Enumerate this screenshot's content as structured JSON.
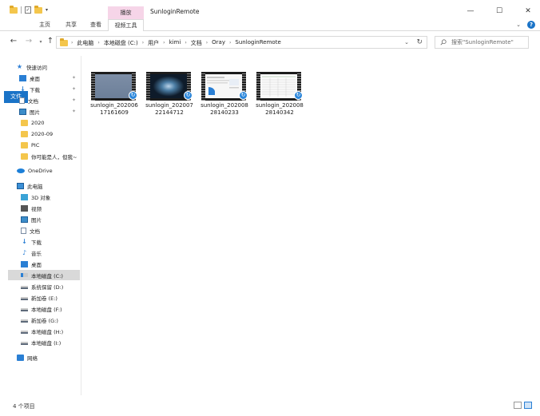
{
  "window": {
    "title": "SunloginRemote",
    "contextual_tab_group": "播放",
    "controls": {
      "minimize": "—",
      "maximize": "☐",
      "close": "✕"
    }
  },
  "ribbon": {
    "tabs": [
      {
        "label": "文件"
      },
      {
        "label": "主页"
      },
      {
        "label": "共享"
      },
      {
        "label": "查看"
      },
      {
        "label": "视频工具"
      }
    ],
    "expand_glyph": "⌄",
    "help_glyph": "?"
  },
  "address": {
    "crumbs": [
      "此电脑",
      "本地磁盘 (C:)",
      "用户",
      "kimi",
      "文档",
      "Oray",
      "SunloginRemote"
    ],
    "search_placeholder": "搜索\"SunloginRemote\""
  },
  "sidebar": {
    "quick_access": {
      "label": "快速访问"
    },
    "pinned": [
      {
        "label": "桌面"
      },
      {
        "label": "下载"
      },
      {
        "label": "文档"
      },
      {
        "label": "图片"
      }
    ],
    "folders": [
      {
        "label": "2020"
      },
      {
        "label": "2020-09"
      },
      {
        "label": "PIC"
      },
      {
        "label": "你可能是人，但我~"
      }
    ],
    "onedrive": {
      "label": "OneDrive"
    },
    "this_pc": {
      "label": "此电脑"
    },
    "pc_items": [
      {
        "label": "3D 对象"
      },
      {
        "label": "视频"
      },
      {
        "label": "图片"
      },
      {
        "label": "文档"
      },
      {
        "label": "下载"
      },
      {
        "label": "音乐"
      },
      {
        "label": "桌面"
      }
    ],
    "drives": [
      {
        "label": "本地磁盘 (C:)"
      },
      {
        "label": "系统保留 (D:)"
      },
      {
        "label": "新加卷 (E:)"
      },
      {
        "label": "本地磁盘 (F:)"
      },
      {
        "label": "新加卷 (G:)"
      },
      {
        "label": "本地磁盘 (H:)"
      },
      {
        "label": "本地磁盘 (I:)"
      }
    ],
    "network": {
      "label": "网络"
    }
  },
  "files": [
    {
      "name": "sunlogin_20200617161609",
      "thumbnail": "gray-screen"
    },
    {
      "name": "sunlogin_20200722144712",
      "thumbnail": "waveform"
    },
    {
      "name": "sunlogin_20200828140233",
      "thumbnail": "document"
    },
    {
      "name": "sunlogin_20200828140342",
      "thumbnail": "spreadsheet"
    }
  ],
  "status": {
    "item_count": "4 个项目"
  },
  "colors": {
    "accent": "#1a73c7",
    "context_tab": "#f6d5e8",
    "selected": "#d9d9d9",
    "folder": "#f4c64c"
  }
}
